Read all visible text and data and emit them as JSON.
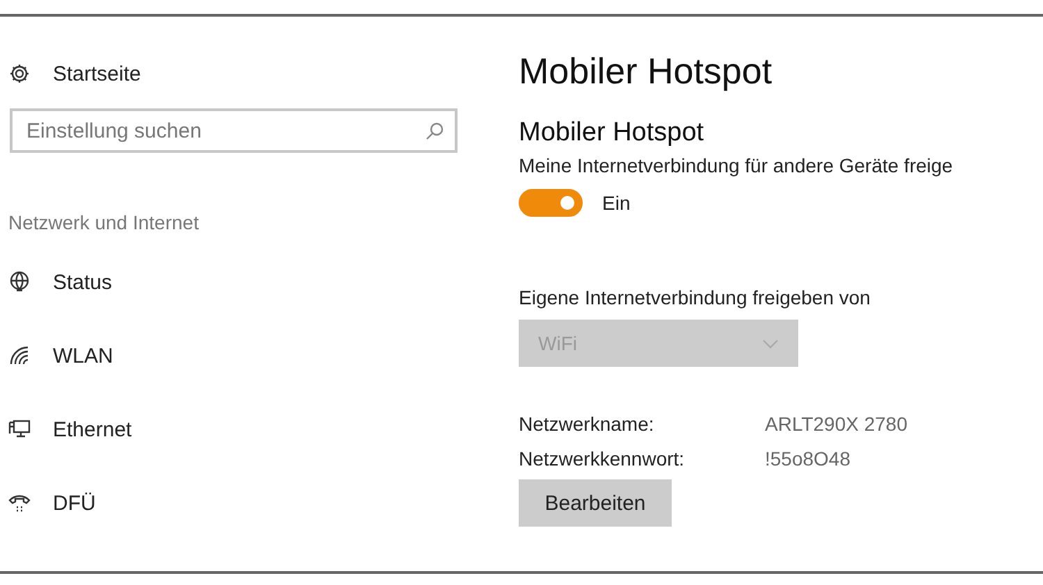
{
  "sidebar": {
    "home": {
      "label": "Startseite"
    },
    "search": {
      "placeholder": "Einstellung suchen"
    },
    "section": "Netzwerk und Internet",
    "items": [
      {
        "kind": "status",
        "label": "Status"
      },
      {
        "kind": "wlan",
        "label": "WLAN"
      },
      {
        "kind": "ethernet",
        "label": "Ethernet"
      },
      {
        "kind": "dialup",
        "label": "DFÜ"
      }
    ]
  },
  "main": {
    "title": "Mobiler Hotspot",
    "section_title": "Mobiler Hotspot",
    "description": "Meine Internetverbindung für andere Geräte freige",
    "toggle": {
      "on": true,
      "label": "Ein"
    },
    "share_from": {
      "label": "Eigene Internetverbindung freigeben von",
      "value": "WiFi",
      "disabled": true
    },
    "fields": [
      {
        "label": "Netzwerkname:",
        "value": "ARLT290X 2780"
      },
      {
        "label": "Netzwerkkennwort:",
        "value": "!55o8O48"
      }
    ],
    "edit_button": "Bearbeiten"
  }
}
